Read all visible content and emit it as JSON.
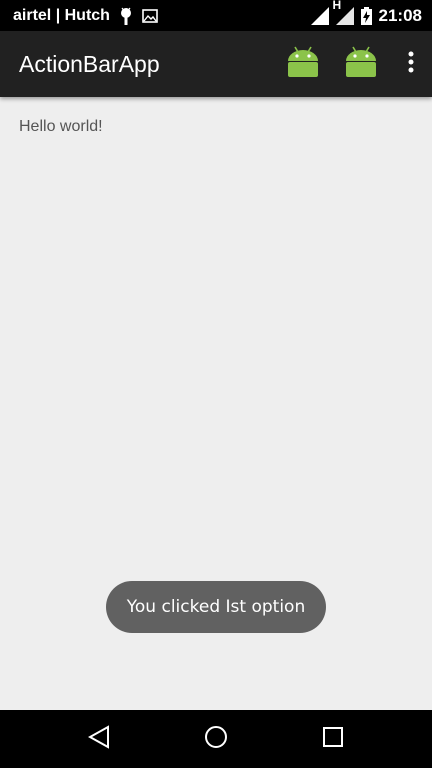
{
  "status_bar": {
    "carrier": "airtel | Hutch",
    "network_type": "H",
    "time": "21:08",
    "icons": [
      "android-notification-icon",
      "image-notification-icon",
      "signal-icon",
      "signal-h-icon",
      "battery-charging-icon"
    ]
  },
  "action_bar": {
    "title": "ActionBarApp",
    "actions": [
      {
        "icon": "android-icon",
        "color": "#8BC34A"
      },
      {
        "icon": "android-icon",
        "color": "#8BC34A"
      }
    ],
    "overflow_icon": "more-vert-icon"
  },
  "content": {
    "hello_text": "Hello world!"
  },
  "toast": {
    "message": "You clicked Ist option"
  },
  "nav_bar": {
    "buttons": [
      "back-icon",
      "home-icon",
      "recents-icon"
    ]
  },
  "colors": {
    "status_bar": "#000000",
    "action_bar": "#212121",
    "background": "#EEEEEE",
    "toast": "#616161",
    "android_green": "#8BC34A"
  }
}
